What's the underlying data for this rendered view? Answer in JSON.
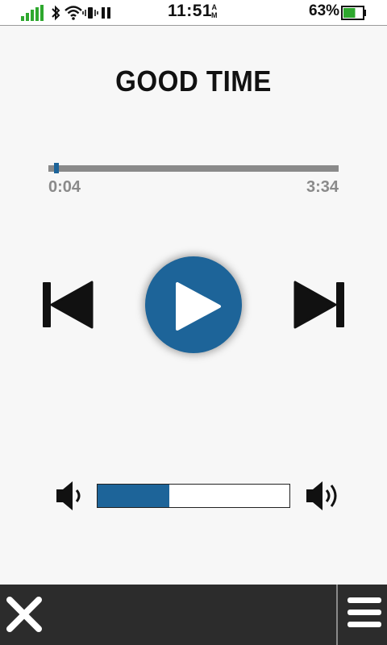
{
  "status_bar": {
    "time": "11:51",
    "am_pm_top": "A",
    "am_pm_bottom": "M",
    "battery_percent": "63%",
    "battery_level": 0.63,
    "icons": [
      "signal-icon",
      "bluetooth-icon",
      "wifi-icon",
      "vibrate-icon",
      "pause-icon",
      "battery-icon"
    ]
  },
  "player": {
    "title": "GOOD TIME",
    "elapsed": "0:04",
    "total": "3:34",
    "progress_fraction": 0.0187,
    "volume_fraction": 0.375
  },
  "colors": {
    "accent": "#1d6499",
    "background": "#f7f7f7",
    "bottom_bar": "#2c2c2c",
    "battery_fill": "#2ea82e",
    "signal": "#2ea82e"
  },
  "bottom_bar": {
    "icons": [
      "close-icon",
      "menu-icon"
    ]
  }
}
